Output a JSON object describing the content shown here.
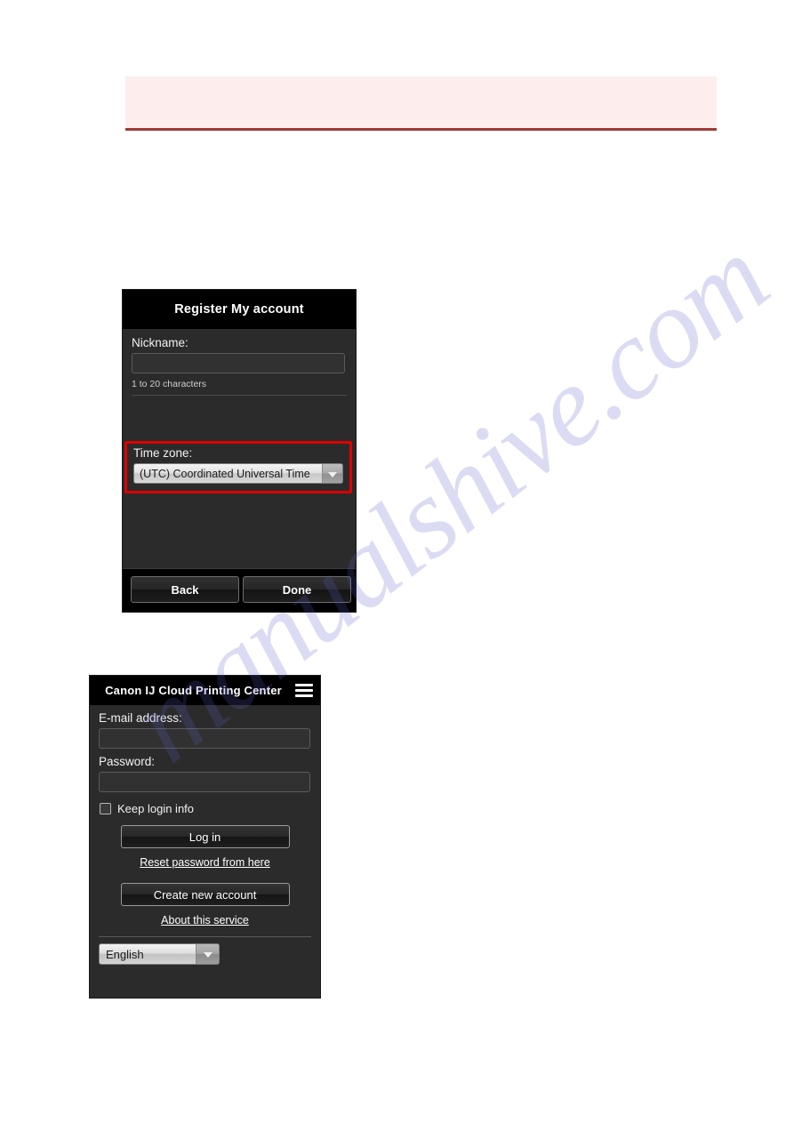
{
  "page": {
    "background_color": "#ffffff",
    "watermark_text": "manualshive.com",
    "watermark_color": "#5b5bc8"
  },
  "note_box": {
    "text": "",
    "background_color": "#fdeeed",
    "rule_color": "#9e3a36"
  },
  "register_panel": {
    "title": "Register My account",
    "nickname": {
      "label": "Nickname:",
      "value": "",
      "placeholder": "",
      "hint": "1 to 20 characters"
    },
    "time_zone": {
      "label": "Time zone:",
      "selected": "(UTC) Coordinated Universal Time",
      "highlight_color": "#e00000"
    },
    "buttons": {
      "back": "Back",
      "done": "Done"
    }
  },
  "login_panel": {
    "title": "Canon IJ Cloud Printing Center",
    "menu_icon": "hamburger-menu-icon",
    "email": {
      "label": "E-mail address:",
      "value": "",
      "placeholder": ""
    },
    "password": {
      "label": "Password:",
      "value": "",
      "placeholder": ""
    },
    "keep_login": {
      "label": "Keep login info",
      "checked": false
    },
    "login_button": "Log in",
    "reset_password_link": "Reset password from here",
    "create_account_button": "Create new account",
    "about_service_link": "About this service",
    "language": {
      "selected": "English"
    }
  }
}
